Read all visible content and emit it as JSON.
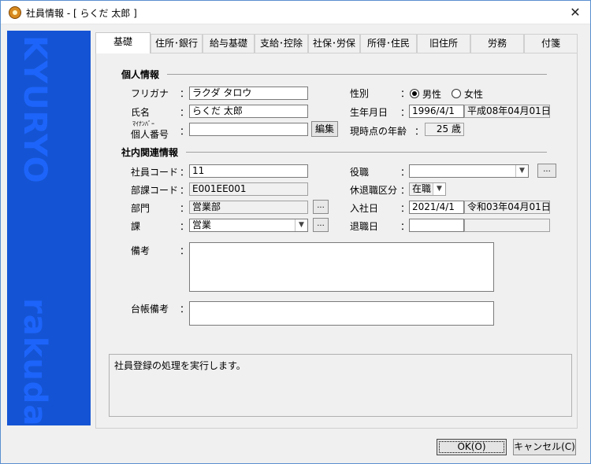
{
  "window": {
    "title": "社員情報 - [ らくだ 太郎 ]",
    "close": "✕"
  },
  "sidebar": {
    "watermark_top": "KYURYO",
    "watermark_bottom": "rakuda"
  },
  "tabs": [
    "基礎",
    "住所･銀行",
    "給与基礎",
    "支給･控除",
    "社保･労保",
    "所得･住民",
    "旧住所",
    "労務",
    "付箋"
  ],
  "personal": {
    "heading": "個人情報",
    "furigana_label": "フリガナ",
    "furigana": "ラクダ タロウ",
    "name_label": "氏名",
    "name": "らくだ 太郎",
    "mynumber_ruby": "ﾏｲﾅﾝﾊﾞｰ",
    "mynumber_label": "個人番号",
    "mynumber": "",
    "edit_button": "編集",
    "gender_label": "性別",
    "male": "男性",
    "female": "女性",
    "birthday_label": "生年月日",
    "birthday": "1996/4/1",
    "birthday_wareki": "平成08年04月01日",
    "age_label": "現時点の年齢",
    "age": "25 歳"
  },
  "company": {
    "heading": "社内関連情報",
    "code_label": "社員コード",
    "code": "11",
    "dept_code_label": "部課コード",
    "dept_code": "E001EE001",
    "dept_label": "部門",
    "dept": "営業部",
    "section_label": "課",
    "section": "営業",
    "position_label": "役職",
    "position": "",
    "status_label": "休退職区分",
    "status": "在職",
    "hire_label": "入社日",
    "hire": "2021/4/1",
    "hire_wareki": "令和03年04月01日",
    "retire_label": "退職日",
    "retire": "",
    "retire_wareki": "",
    "ellipsis": "...",
    "remarks_label": "備考",
    "ledger_label": "台帳備考"
  },
  "colon": "：",
  "message": "社員登録の処理を実行します。",
  "buttons": {
    "ok": "OK(O)",
    "cancel": "キャンセル(C)"
  }
}
